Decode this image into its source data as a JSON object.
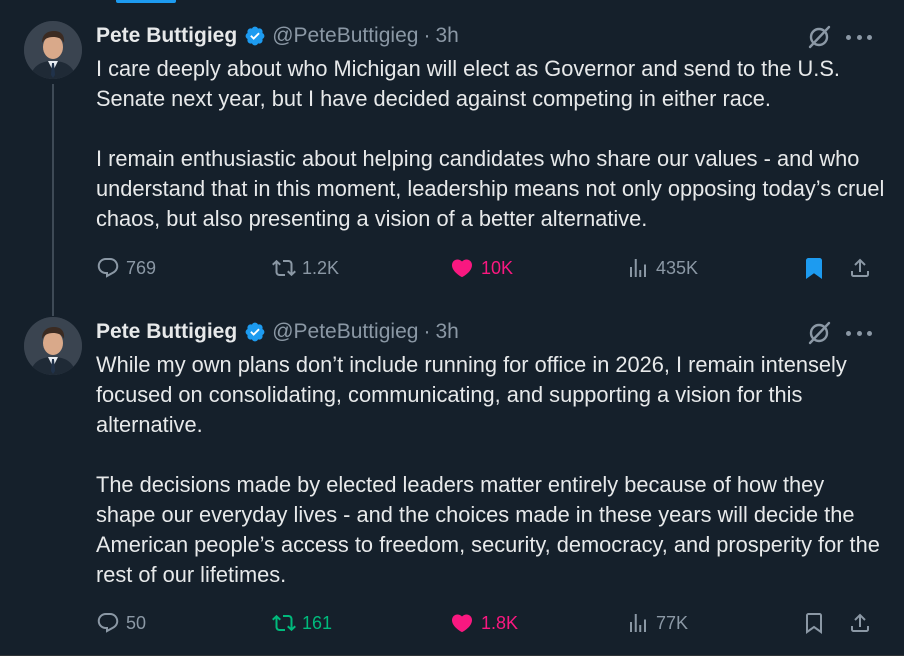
{
  "colors": {
    "background": "#15202b",
    "text_primary": "#e7e9ea",
    "text_secondary": "#8b98a5",
    "verified_blue": "#1d9bf0",
    "like_pink": "#f91880",
    "repost_green": "#00ba7c"
  },
  "tweets": [
    {
      "author": {
        "name": "Pete Buttigieg",
        "handle": "@PeteButtigieg",
        "verified": true
      },
      "separator": "·",
      "time": "3h",
      "paragraphs": [
        "I care deeply about who Michigan will elect as Governor and send to the U.S. Senate next year, but I have decided against competing in either race.",
        "I remain enthusiastic about helping candidates who share our values - and who understand that in this moment, leadership means not only opposing today’s cruel chaos, but also presenting a vision of a better alternative."
      ],
      "actions": {
        "replies": "769",
        "reposts": "1.2K",
        "reposted": false,
        "likes": "10K",
        "liked": true,
        "views": "435K",
        "bookmarked": true
      },
      "icons": [
        "reply-icon",
        "repost-icon",
        "heart-icon",
        "views-icon",
        "bookmark-icon",
        "share-icon",
        "grok-icon",
        "more-icon",
        "verified-badge-icon"
      ]
    },
    {
      "author": {
        "name": "Pete Buttigieg",
        "handle": "@PeteButtigieg",
        "verified": true
      },
      "separator": "·",
      "time": "3h",
      "paragraphs": [
        "While my own plans don’t include running for office in 2026, I remain intensely focused on consolidating, communicating, and supporting a vision for this alternative.",
        "The decisions made by elected leaders matter entirely because of how they shape our everyday lives - and the choices made in these years will decide the American people’s access to freedom, security, democracy, and prosperity for the rest of our lifetimes."
      ],
      "actions": {
        "replies": "50",
        "reposts": "161",
        "reposted": true,
        "likes": "1.8K",
        "liked": true,
        "views": "77K",
        "bookmarked": false
      },
      "icons": [
        "reply-icon",
        "repost-icon",
        "heart-icon",
        "views-icon",
        "bookmark-icon",
        "share-icon",
        "grok-icon",
        "more-icon",
        "verified-badge-icon"
      ]
    }
  ]
}
